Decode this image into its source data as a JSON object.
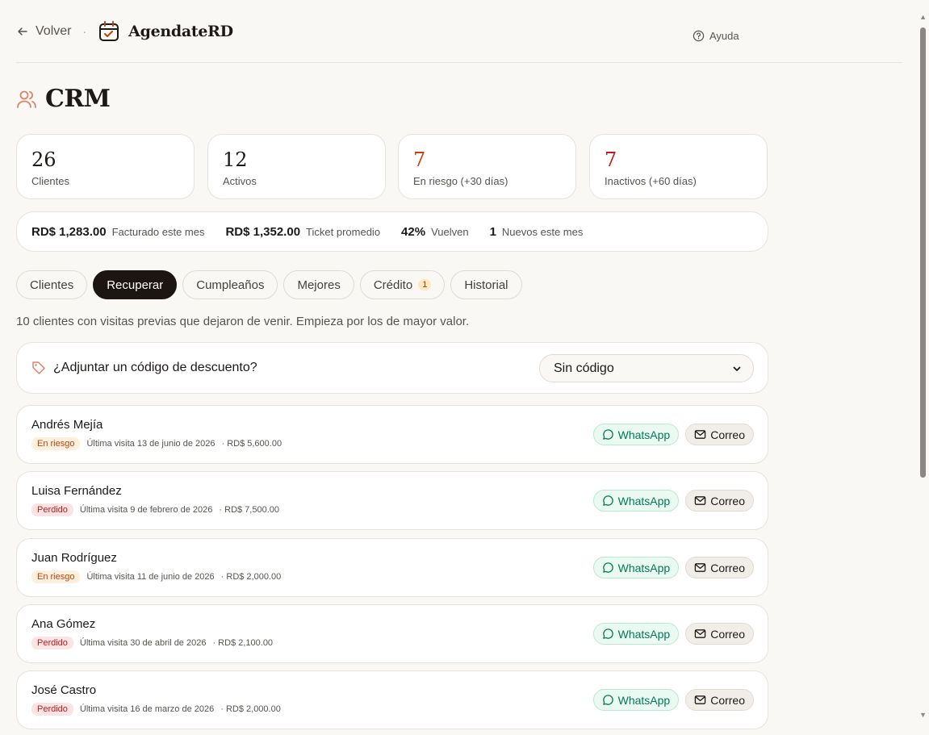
{
  "header": {
    "back_label": "Volver",
    "separator": "·",
    "brand": "AgendateRD",
    "help_label": "Ayuda"
  },
  "page": {
    "title": "CRM"
  },
  "stats": [
    {
      "value": "26",
      "label": "Clientes",
      "color": "#1c1917"
    },
    {
      "value": "12",
      "label": "Activos",
      "color": "#1c1917"
    },
    {
      "value": "7",
      "label": "En riesgo (+30 días)",
      "color": "#c2410c"
    },
    {
      "value": "7",
      "label": "Inactivos (+60 días)",
      "color": "#b91c1c"
    }
  ],
  "summary": [
    {
      "value": "RD$ 1,283.00",
      "label": "Facturado este mes"
    },
    {
      "value": "RD$ 1,352.00",
      "label": "Ticket promedio"
    },
    {
      "value": "42%",
      "label": "Vuelven"
    },
    {
      "value": "1",
      "label": "Nuevos este mes"
    }
  ],
  "tabs": [
    {
      "label": "Clientes"
    },
    {
      "label": "Recuperar",
      "active": true
    },
    {
      "label": "Cumpleaños"
    },
    {
      "label": "Mejores"
    },
    {
      "label": "Crédito",
      "badge": "1"
    },
    {
      "label": "Historial"
    }
  ],
  "description": "10 clientes con visitas previas que dejaron de venir. Empieza por los de mayor valor.",
  "coupon": {
    "question": "¿Adjuntar un código de descuento?",
    "selected": "Sin código"
  },
  "actions": {
    "whatsapp": "WhatsApp",
    "email": "Correo"
  },
  "clients": [
    {
      "name": "Andrés Mejía",
      "status": "En riesgo",
      "status_type": "riesgo",
      "last_visit": "Última visita 13 de junio de 2026",
      "amount": "· RD$ 5,600.00"
    },
    {
      "name": "Luisa Fernández",
      "status": "Perdido",
      "status_type": "perdido",
      "last_visit": "Última visita 9 de febrero de 2026",
      "amount": "· RD$ 7,500.00"
    },
    {
      "name": "Juan Rodríguez",
      "status": "En riesgo",
      "status_type": "riesgo",
      "last_visit": "Última visita 11 de junio de 2026",
      "amount": "· RD$ 2,000.00"
    },
    {
      "name": "Ana Gómez",
      "status": "Perdido",
      "status_type": "perdido",
      "last_visit": "Última visita 30 de abril de 2026",
      "amount": "· RD$ 2,100.00"
    },
    {
      "name": "José Castro",
      "status": "Perdido",
      "status_type": "perdido",
      "last_visit": "Última visita 16 de marzo de 2026",
      "amount": "· RD$ 2,000.00"
    }
  ]
}
